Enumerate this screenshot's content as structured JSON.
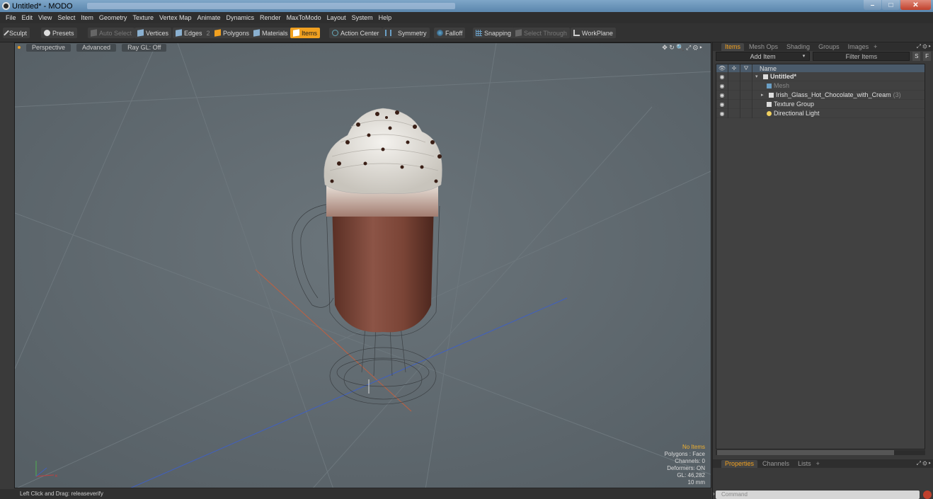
{
  "window": {
    "title": "Untitled* - MODO",
    "min": "–",
    "max": "□",
    "close": "✕"
  },
  "menu": [
    "File",
    "Edit",
    "View",
    "Select",
    "Item",
    "Geometry",
    "Texture",
    "Vertex Map",
    "Animate",
    "Dynamics",
    "Render",
    "MaxToModo",
    "Layout",
    "System",
    "Help"
  ],
  "toolbar": {
    "sculpt": "Sculpt",
    "presets": "Presets",
    "auto_select": "Auto Select",
    "vertices": "Vertices",
    "edges": "Edges",
    "edges_num": "2",
    "polygons": "Polygons",
    "materials": "Materials",
    "items": "Items",
    "action_center": "Action Center",
    "symmetry": "Symmetry",
    "falloff": "Falloff",
    "snapping": "Snapping",
    "select_through": "Select Through",
    "workplane": "WorkPlane"
  },
  "viewport": {
    "tabs": [
      "Perspective",
      "Advanced",
      "Ray GL: Off"
    ],
    "tools": "✥ ↻ 🔍 ⤢ ⚙ ▸",
    "stats": {
      "no_items": "No Items",
      "polygons": "Polygons : Face",
      "channels": "Channels: 0",
      "deformers": "Deformers: ON",
      "gl": "GL: 46,282",
      "unit": "10 mm"
    }
  },
  "status": "Left Click and Drag:  releaseverify",
  "panel": {
    "tabs": [
      "Items",
      "Mesh Ops",
      "Shading",
      "Groups",
      "Images"
    ],
    "plus": "+",
    "icons": "⤢ ⚙ ▸",
    "add_item": "Add Item",
    "add_item_arrow": "▾",
    "filter": "Filter Items",
    "s_btn": "S",
    "f_btn": "F",
    "head": {
      "eye": "👁",
      "lock": "✢",
      "col3": "⛛",
      "name": "Name"
    },
    "tree": [
      {
        "label": "Untitled*",
        "count": ""
      },
      {
        "label": "Mesh",
        "count": ""
      },
      {
        "label": "Irish_Glass_Hot_Chocolate_with_Cream",
        "count": "(3)"
      },
      {
        "label": "Texture Group",
        "count": ""
      },
      {
        "label": "Directional Light",
        "count": ""
      }
    ]
  },
  "bottom_tabs": [
    "Properties",
    "Channels",
    "Lists"
  ],
  "command_placeholder": "Command"
}
